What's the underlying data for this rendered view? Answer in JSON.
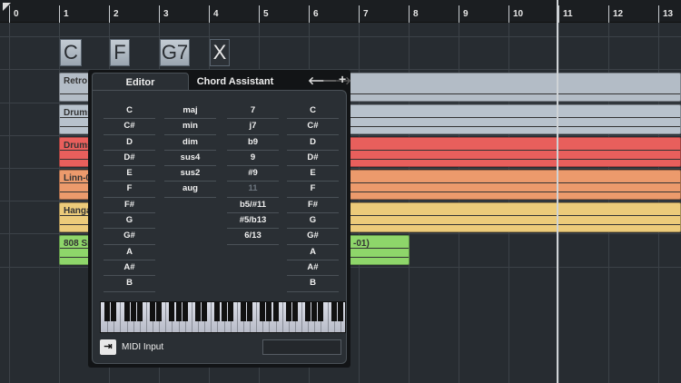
{
  "ruler": {
    "bars": [
      "0",
      "1",
      "2",
      "3",
      "4",
      "5",
      "6",
      "7",
      "8",
      "9",
      "10",
      "11",
      "12",
      "13"
    ]
  },
  "chord_track": {
    "events": [
      "C",
      "F",
      "G7",
      "X"
    ]
  },
  "tracks": [
    {
      "name": "Retro",
      "color": "#b3bcc6"
    },
    {
      "name": "Drums",
      "color": "#b8c2cc"
    },
    {
      "name": "Drums",
      "color": "#e85f5c"
    },
    {
      "name": "Linn-0",
      "color": "#ec9a6c"
    },
    {
      "name": "Hanga",
      "color": "#eccb7a"
    },
    {
      "name": "808 Sn",
      "color": "#8ed66a",
      "suffix": "-01)"
    }
  ],
  "dialog": {
    "tabs": [
      "Editor",
      "Chord Assistant"
    ],
    "nav": {
      "back": "🡐",
      "forward": "🡒",
      "add": "+"
    },
    "roots": [
      "C",
      "C#",
      "D",
      "D#",
      "E",
      "F",
      "F#",
      "G",
      "G#",
      "A",
      "A#",
      "B"
    ],
    "types": [
      "maj",
      "min",
      "dim",
      "sus4",
      "sus2",
      "aug"
    ],
    "tensions": [
      "7",
      "j7",
      "b9",
      "9",
      "#9",
      "11",
      "b5/#11",
      "#5/b13",
      "6/13"
    ],
    "disabled_tension": "11",
    "bass": [
      "C",
      "C#",
      "D",
      "D#",
      "E",
      "F",
      "F#",
      "G",
      "G#",
      "A",
      "A#",
      "B"
    ],
    "midi_input_label": "MIDI Input",
    "midi_input_value": ""
  }
}
